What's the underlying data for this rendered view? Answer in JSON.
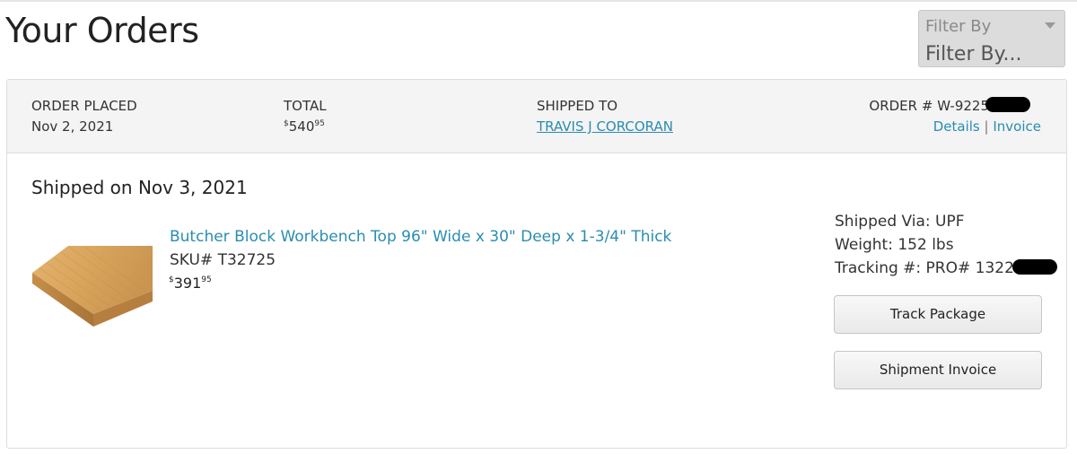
{
  "page": {
    "title": "Your Orders"
  },
  "filter": {
    "label": "Filter By",
    "value": "Filter By..."
  },
  "order": {
    "placed_label": "ORDER PLACED",
    "placed_date": "Nov 2, 2021",
    "total_label": "TOTAL",
    "total": {
      "currency": "$",
      "whole": "540",
      "cents": "95"
    },
    "shipped_to_label": "SHIPPED TO",
    "shipped_to": "TRAVIS J CORCORAN",
    "order_number_label": "ORDER # W-9225",
    "details_link": "Details",
    "separator": "|",
    "invoice_link": "Invoice"
  },
  "shipment": {
    "shipped_on": "Shipped on Nov 3, 2021",
    "via": "Shipped Via: UPF",
    "weight": "Weight: 152 lbs",
    "tracking": "Tracking #: PRO# 1322",
    "track_button": "Track Package",
    "invoice_button": "Shipment Invoice"
  },
  "product": {
    "title": "Butcher Block Workbench Top 96\" Wide x 30\" Deep x 1-3/4\" Thick",
    "sku": "SKU# T32725",
    "price": {
      "currency": "$",
      "whole": "391",
      "cents": "95"
    },
    "image_icon": "butcher-block-image"
  },
  "colors": {
    "link": "#2a8db0",
    "header_bg": "#f4f4f4",
    "redaction": "#000000"
  }
}
